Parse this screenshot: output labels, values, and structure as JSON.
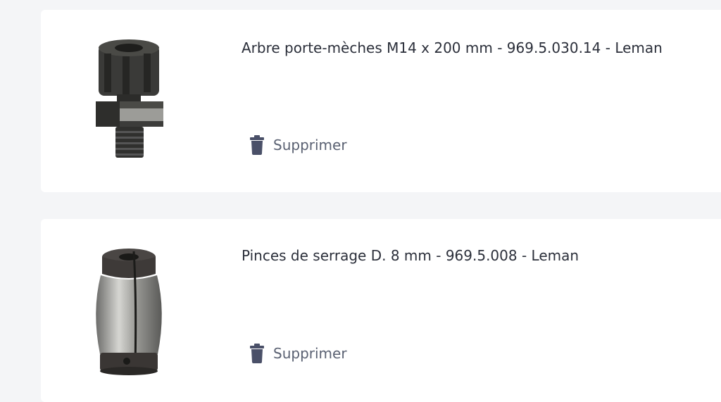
{
  "items": [
    {
      "title": "Arbre porte-mèches M14 x 200 mm - 969.5.030.14 - Leman",
      "remove_label": "Supprimer",
      "image_icon": "tool-shaft-collet-nut-image"
    },
    {
      "title": "Pinces de serrage D. 8 mm - 969.5.008 - Leman",
      "remove_label": "Supprimer",
      "image_icon": "collet-clamp-image"
    }
  ],
  "colors": {
    "background": "#f4f5f7",
    "card": "#ffffff",
    "title_text": "#2b2f3a",
    "action_text": "#5a6172",
    "trash_icon": "#4a5068"
  }
}
